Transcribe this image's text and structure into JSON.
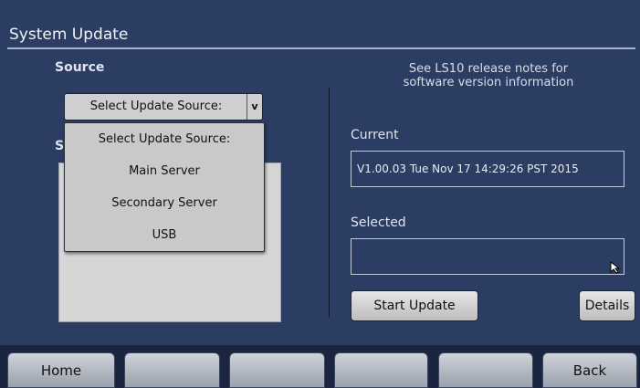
{
  "screen": {
    "title": "System Update"
  },
  "left": {
    "source_label": "Source",
    "select_value": "Select Update Source:",
    "select_chevron": "v",
    "hidden_label_partial": "S",
    "dropdown_options": [
      "Select Update Source:",
      "Main Server",
      "Secondary Server",
      "USB"
    ]
  },
  "right": {
    "release_notes_line1": "See LS10 release notes for",
    "release_notes_line2": "software version information",
    "current_label": "Current",
    "current_value": "V1.00.03 Tue Nov 17 14:29:26 PST 2015",
    "selected_label": "Selected",
    "selected_value": "",
    "start_update_button": "Start Update",
    "details_button": "Details"
  },
  "nav": {
    "home": "Home",
    "btn2": "",
    "btn3": "",
    "btn4": "",
    "btn5": "",
    "back": "Back"
  },
  "colors": {
    "background": "#2c3d63",
    "button_face": "#cfcfcf",
    "bottom_bar": "#1a2640"
  },
  "icons": {
    "cursor": "mouse-pointer-icon",
    "chevron": "chevron-down-icon"
  }
}
